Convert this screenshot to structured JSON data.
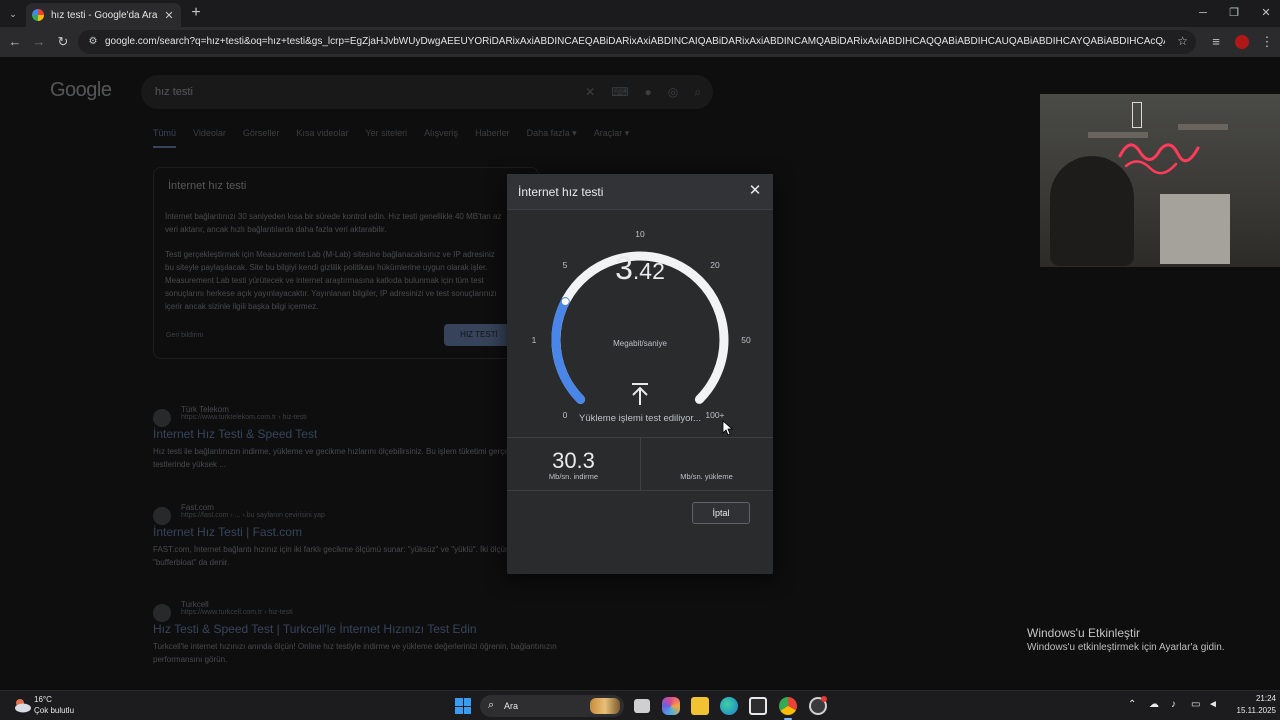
{
  "browser": {
    "tab_title": "hız testi - Google'da Ara",
    "url": "google.com/search?q=hız+testi&oq=hız+testi&gs_lcrp=EgZjaHJvbWUyDwgAEEUYORiDARixAxiABDINCAEQABiDARixAxiABDINCAIQABiDARixAxiABDINCAMQABiDARixAxiABDIHCAQQABiABDIHCAUQABiABDIHCAYQABiABDIHCAcQABiABDIHCAgQABiPAjIHCA..."
  },
  "google": {
    "logo": "Google",
    "query": "hız testi",
    "tabs": [
      "Tümü",
      "Videolar",
      "Görseller",
      "Kısa videolar",
      "Yer siteleri",
      "Alışveriş",
      "Haberler",
      "Daha fazla ▾",
      "Araçlar ▾"
    ],
    "card": {
      "title": "İnternet hız testi",
      "p1": "İnternet bağlantınızı 30 saniyeden kısa bir sürede kontrol edin. Hız testi genellikle 40 MB'tan az veri aktarır, ancak hızlı bağlantılarda daha fazla veri aktarabilir.",
      "p2": "Testi gerçekleştirmek için Measurement Lab (M-Lab) sitesine bağlanacaksınız ve IP adresiniz bu siteyle paylaşılacak. Site bu bilgiyi kendi gizlilik politikası hükümlerine uygun olarak işler. Measurement Lab testi yürütecek ve internet araştırmasına katkıda bulunmak için tüm test sonuçlarını herkese açık yayınlayacaktır. Yayınlanan bilgiler, IP adresinizi ve test sonuçlarınızı içerir ancak sizinle ilgili başka bilgi içermez.",
      "button": "HIZ TESTİ",
      "footer": "Geri bildirim"
    },
    "results": [
      {
        "site": "Türk Telekom",
        "url": "https://www.turktelekom.com.tr › hiz-testi",
        "title": "İnternet Hız Testi & Speed Test",
        "snippet": "Hız testi ile bağlantınızın indirme, yükleme ve gecikme hızlarını ölçebilirsiniz. Bu işlem tüketimi gerçekleşebilir. 5G hız testlerinde yüksek ..."
      },
      {
        "site": "Fast.com",
        "url": "https://fast.com › ... › bu sayfanın çevirisini yap",
        "title": "İnternet Hız Testi | Fast.com",
        "snippet": "FAST.com, İnternet bağlantı hızınız için iki farklı gecikme ölçümü sunar: \"yüksüz\" ve \"yüklü\". İki ölçüm arasındaki farka \"bufferbloat\" da denir."
      },
      {
        "site": "Turkcell",
        "url": "https://www.turkcell.com.tr › hiz-testi",
        "title": "Hız Testi & Speed Test | Turkcell'le İnternet Hızınızı Test Edin",
        "snippet": "Turkcell'le internet hızınızı anında ölçün! Online hız testiyle indirme ve yükleme değerlerinizi öğrenin, bağlantınızın performansını görün."
      }
    ]
  },
  "speedtest": {
    "title": "İnternet hız testi",
    "gauge_ticks": [
      "0",
      "1",
      "5",
      "10",
      "20",
      "50",
      "100+"
    ],
    "current_value": 3.42,
    "value_int": "3",
    "value_dec": ".42",
    "unit": "Megabit/saniye",
    "status": "Yükleme işlemi test ediliyor...",
    "download_value": "30.3",
    "download_label": "Mb/sn. indirme",
    "upload_value": "",
    "upload_label": "Mb/sn. yükleme",
    "cancel_label": "İptal",
    "colors": {
      "progress": "#4a85e8",
      "track": "#f1f3f4"
    }
  },
  "watermark": {
    "title": "Windows'u Etkinleştir",
    "subtitle": "Windows'u etkinleştirmek için Ayarlar'a gidin."
  },
  "taskbar": {
    "temperature": "16°C",
    "weather": "Çok bulutlu",
    "search_label": "Ara",
    "time": "21:24",
    "date": "15.11.2025"
  }
}
